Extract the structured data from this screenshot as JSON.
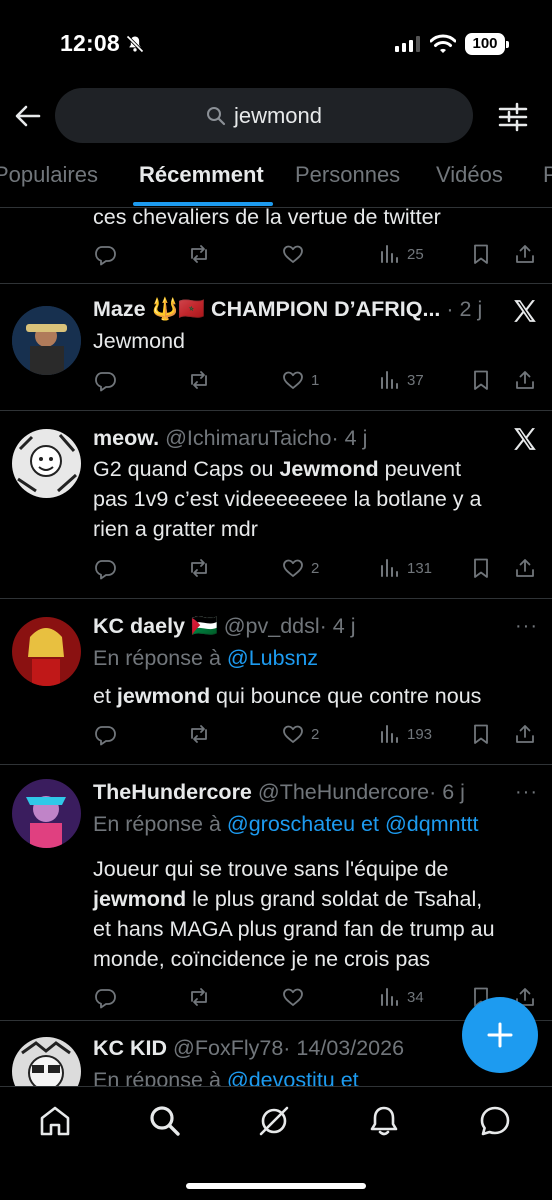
{
  "status_bar": {
    "time": "12:08",
    "battery": "100"
  },
  "search": {
    "query": "jewmond"
  },
  "tabs": [
    {
      "label": "Populaires"
    },
    {
      "label": "Récemment"
    },
    {
      "label": "Personnes"
    },
    {
      "label": "Vidéos"
    },
    {
      "label": "P"
    }
  ],
  "tweets": [
    {
      "text_tail": "ces chevaliers de la vertue de twitter",
      "replies": "",
      "retweets": "",
      "likes": "",
      "views": "25"
    },
    {
      "name": "Maze 🔱🇲🇦 CHAMPION D’AFRIQ...",
      "time": "· 2 j",
      "text": "Jewmond",
      "replies": "",
      "retweets": "",
      "likes": "1",
      "views": "37"
    },
    {
      "name": "meow.",
      "handle": "@IchimaruTaicho",
      "time": "· 4 j",
      "text_line1_pre": "G2 quand Caps ou ",
      "text_line1_bold": "Jewmond",
      "text_line1_post": " peuvent",
      "text_line2": "pas 1v9 c’est videeeeeeee la botlane y a",
      "text_line3": "rien a gratter mdr",
      "replies": "",
      "retweets": "",
      "likes": "2",
      "views": "131"
    },
    {
      "name": "KC daely 🇵🇸",
      "handle": "@pv_ddsl",
      "time": "· 4 j",
      "reply_prefix": "En réponse à ",
      "reply_to": "@Lubsnz",
      "text_pre": "et ",
      "text_bold": "jewmond",
      "text_post": " qui bounce que contre nous",
      "replies": "",
      "retweets": "",
      "likes": "2",
      "views": "193"
    },
    {
      "name": "TheHundercore",
      "handle": "@TheHundercore",
      "time": "· 6 j",
      "reply_prefix": "En réponse à ",
      "reply_to": "@groschateu et @dqmnttt",
      "text_line1": "Joueur qui se trouve sans l'équipe de",
      "text_line2_bold": "jewmond",
      "text_line2_post": " le plus grand soldat de Tsahal,",
      "text_line3": "et hans MAGA plus grand fan de trump au",
      "text_line4": "monde, coïncidence je ne crois pas",
      "replies": "",
      "retweets": "",
      "likes": "",
      "views": "34"
    },
    {
      "name": "KC KID",
      "handle": "@FoxFly78",
      "time": "· 14/03/2026",
      "reply_prefix": "En réponse à ",
      "reply_to": "@devostitu et"
    }
  ],
  "colors": {
    "accent": "#1d9bf0",
    "muted": "#71767b",
    "background": "#000000",
    "divider": "#2f3336"
  },
  "icons": [
    "back-arrow-icon",
    "search-icon",
    "filter-icon",
    "reply-icon",
    "retweet-icon",
    "like-icon",
    "views-icon",
    "bookmark-icon",
    "share-icon",
    "x-logo-icon",
    "more-icon",
    "plus-icon",
    "home-icon",
    "explore-icon",
    "grok-icon",
    "notifications-icon",
    "messages-icon"
  ]
}
